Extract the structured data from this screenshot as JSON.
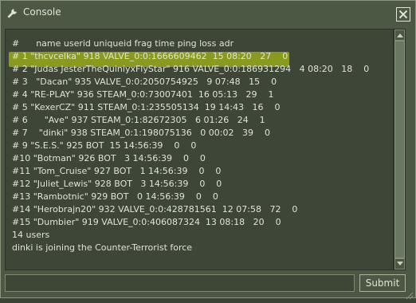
{
  "window": {
    "title": "Console",
    "close_glyph": "✕"
  },
  "icons": {
    "title": "wrench-icon",
    "close": "close-icon",
    "scroll_up": "up-arrow-icon",
    "scroll_down": "down-arrow-icon"
  },
  "colors": {
    "highlight": "#8a9a1e",
    "text": "#dfe3d8",
    "panel": "#4c5844",
    "output_bg": "#3e4637"
  },
  "console": {
    "highlighted_line": 1,
    "lines": [
      "#      name userid uniqueid frag time ping loss adr",
      "# 1 \"thcvcelka\" 918 VALVE_0:0:1666609462  15 08:20   27    0",
      "# 2 \"Judas JesterTheQuiniyxFlyStar\" 916 VALVE_0:0:186931294   4 08:20   18    0",
      "# 3   \"Dacan\" 935 VALVE_0:0:2050754925   9 07:48   15    0",
      "# 4 \"RE-PLAY\" 936 STEAM_0:0:73007401  16 05:13   29    1",
      "# 5 \"KexerCZ\" 911 STEAM_0:1:235505134  19 14:43   16    0",
      "# 6      \"Ave\" 937 STEAM_0:1:82672305   6 01:26   24    1",
      "# 7    \"dinki\" 938 STEAM_0:1:198075136   0 00:02   39    0",
      "# 9 \"S.E.S.\" 925 BOT  15 14:56:39    0    0",
      "#10 \"Botman\" 926 BOT   3 14:56:39    0    0",
      "#11 \"Tom_Cruise\" 927 BOT   1 14:56:39    0    0",
      "#12 \"Juliet_Lewis\" 928 BOT   3 14:56:39    0    0",
      "#13 \"Rambotnic\" 929 BOT   0 14:56:39    0    0",
      "#14 \"Herobrajn20\" 932 VALVE_0:0:428781561  12 07:58   72    0",
      "#15 \"Dumbier\" 919 VALVE_0:0:406087324  13 08:18   20    0",
      "14 users",
      "dinki is joining the Counter-Terrorist force"
    ]
  },
  "input": {
    "value": "",
    "placeholder": ""
  },
  "submit_label": "Submit"
}
